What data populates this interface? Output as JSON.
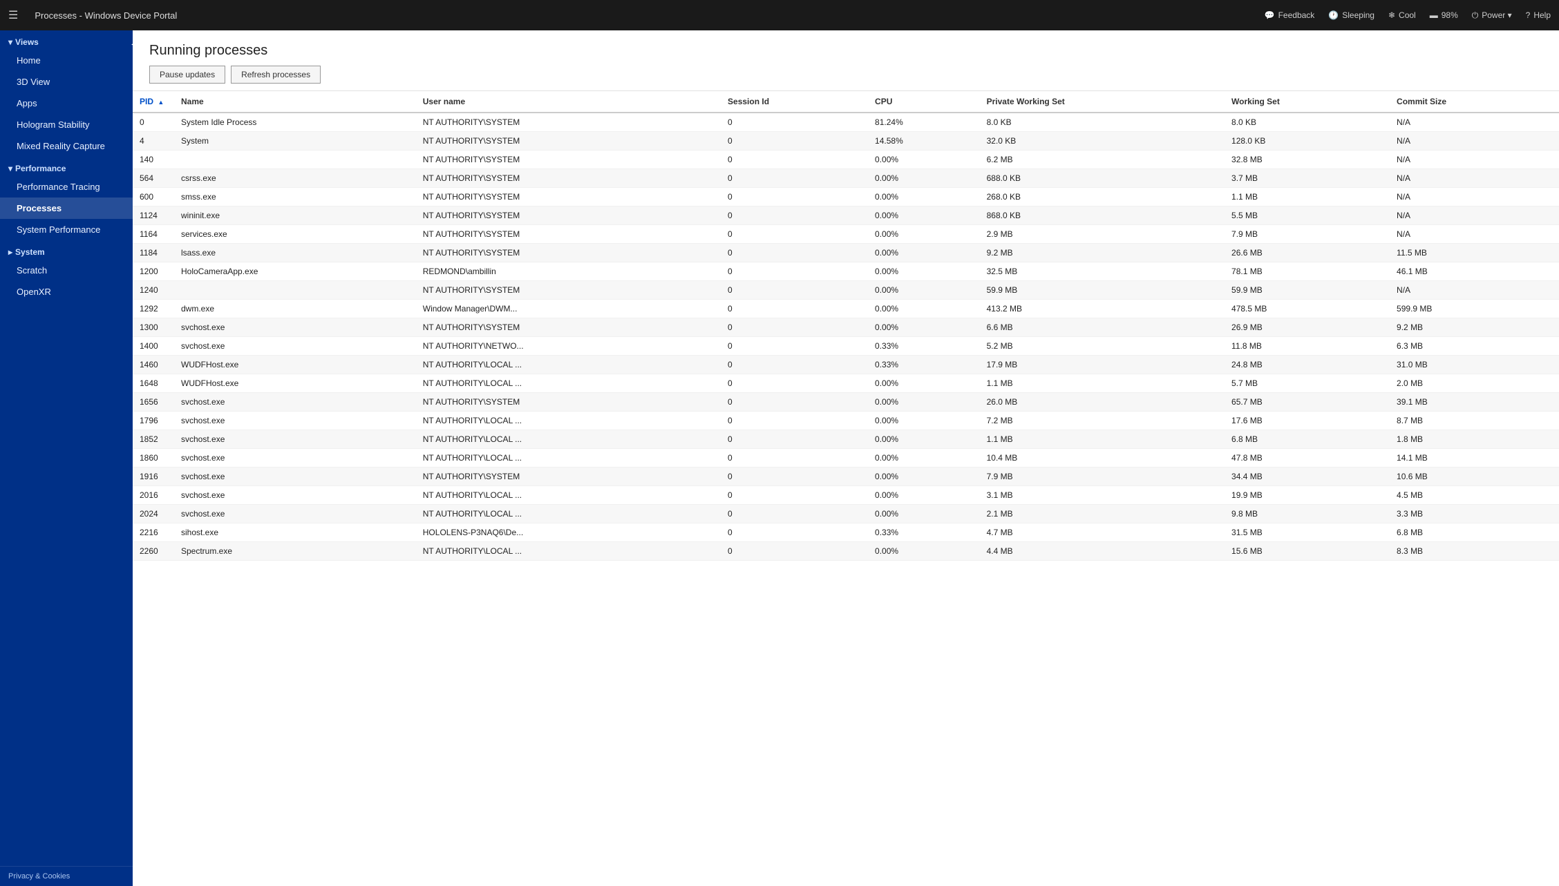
{
  "topbar": {
    "menu_icon": "☰",
    "title": "Processes - Windows Device Portal",
    "actions": [
      {
        "id": "feedback",
        "icon": "💬",
        "label": "Feedback"
      },
      {
        "id": "sleeping",
        "icon": "🕐",
        "label": "Sleeping"
      },
      {
        "id": "cool",
        "icon": "❄",
        "label": "Cool"
      },
      {
        "id": "battery",
        "icon": "🔋",
        "label": "98%"
      },
      {
        "id": "power",
        "icon": "⏻",
        "label": "Power ▾"
      },
      {
        "id": "help",
        "icon": "?",
        "label": "Help"
      }
    ]
  },
  "sidebar": {
    "toggle_icon": "◀",
    "sections": [
      {
        "id": "views",
        "label": "▾Views",
        "items": [
          {
            "id": "home",
            "label": "Home"
          },
          {
            "id": "3d-view",
            "label": "3D View"
          },
          {
            "id": "apps",
            "label": "Apps"
          }
        ]
      },
      {
        "id": "standalone",
        "items": [
          {
            "id": "hologram-stability",
            "label": "Hologram Stability"
          },
          {
            "id": "mixed-reality-capture",
            "label": "Mixed Reality Capture"
          }
        ]
      },
      {
        "id": "performance",
        "label": "▾Performance",
        "items": [
          {
            "id": "performance-tracing",
            "label": "Performance Tracing"
          },
          {
            "id": "processes",
            "label": "Processes",
            "active": true
          },
          {
            "id": "system-performance",
            "label": "System Performance"
          }
        ]
      },
      {
        "id": "system",
        "label": "▸System",
        "items": []
      },
      {
        "id": "scratch-openxr",
        "items": [
          {
            "id": "scratch",
            "label": "Scratch"
          },
          {
            "id": "openxr",
            "label": "OpenXR"
          }
        ]
      }
    ],
    "footer": "Privacy & Cookies"
  },
  "main": {
    "title": "Running processes",
    "buttons": [
      {
        "id": "pause-updates",
        "label": "Pause updates"
      },
      {
        "id": "refresh-processes",
        "label": "Refresh processes"
      }
    ],
    "table": {
      "columns": [
        {
          "id": "pid",
          "label": "PID",
          "sorted": true
        },
        {
          "id": "name",
          "label": "Name"
        },
        {
          "id": "username",
          "label": "User name"
        },
        {
          "id": "session",
          "label": "Session Id"
        },
        {
          "id": "cpu",
          "label": "CPU"
        },
        {
          "id": "private-ws",
          "label": "Private Working Set"
        },
        {
          "id": "working-set",
          "label": "Working Set"
        },
        {
          "id": "commit",
          "label": "Commit Size"
        }
      ],
      "rows": [
        {
          "pid": "0",
          "name": "System Idle Process",
          "username": "NT AUTHORITY\\SYSTEM",
          "session": "0",
          "cpu": "81.24%",
          "private_ws": "8.0 KB",
          "working_set": "8.0 KB",
          "commit": "N/A"
        },
        {
          "pid": "4",
          "name": "System",
          "username": "NT AUTHORITY\\SYSTEM",
          "session": "0",
          "cpu": "14.58%",
          "private_ws": "32.0 KB",
          "working_set": "128.0 KB",
          "commit": "N/A"
        },
        {
          "pid": "140",
          "name": "",
          "username": "NT AUTHORITY\\SYSTEM",
          "session": "0",
          "cpu": "0.00%",
          "private_ws": "6.2 MB",
          "working_set": "32.8 MB",
          "commit": "N/A"
        },
        {
          "pid": "564",
          "name": "csrss.exe",
          "username": "NT AUTHORITY\\SYSTEM",
          "session": "0",
          "cpu": "0.00%",
          "private_ws": "688.0 KB",
          "working_set": "3.7 MB",
          "commit": "N/A"
        },
        {
          "pid": "600",
          "name": "smss.exe",
          "username": "NT AUTHORITY\\SYSTEM",
          "session": "0",
          "cpu": "0.00%",
          "private_ws": "268.0 KB",
          "working_set": "1.1 MB",
          "commit": "N/A"
        },
        {
          "pid": "1124",
          "name": "wininit.exe",
          "username": "NT AUTHORITY\\SYSTEM",
          "session": "0",
          "cpu": "0.00%",
          "private_ws": "868.0 KB",
          "working_set": "5.5 MB",
          "commit": "N/A"
        },
        {
          "pid": "1164",
          "name": "services.exe",
          "username": "NT AUTHORITY\\SYSTEM",
          "session": "0",
          "cpu": "0.00%",
          "private_ws": "2.9 MB",
          "working_set": "7.9 MB",
          "commit": "N/A"
        },
        {
          "pid": "1184",
          "name": "lsass.exe",
          "username": "NT AUTHORITY\\SYSTEM",
          "session": "0",
          "cpu": "0.00%",
          "private_ws": "9.2 MB",
          "working_set": "26.6 MB",
          "commit": "11.5 MB"
        },
        {
          "pid": "1200",
          "name": "HoloCameraApp.exe",
          "username": "REDMOND\\ambillin",
          "session": "0",
          "cpu": "0.00%",
          "private_ws": "32.5 MB",
          "working_set": "78.1 MB",
          "commit": "46.1 MB"
        },
        {
          "pid": "1240",
          "name": "",
          "username": "NT AUTHORITY\\SYSTEM",
          "session": "0",
          "cpu": "0.00%",
          "private_ws": "59.9 MB",
          "working_set": "59.9 MB",
          "commit": "N/A"
        },
        {
          "pid": "1292",
          "name": "dwm.exe",
          "username": "Window Manager\\DWM...",
          "session": "0",
          "cpu": "0.00%",
          "private_ws": "413.2 MB",
          "working_set": "478.5 MB",
          "commit": "599.9 MB"
        },
        {
          "pid": "1300",
          "name": "svchost.exe",
          "username": "NT AUTHORITY\\SYSTEM",
          "session": "0",
          "cpu": "0.00%",
          "private_ws": "6.6 MB",
          "working_set": "26.9 MB",
          "commit": "9.2 MB"
        },
        {
          "pid": "1400",
          "name": "svchost.exe",
          "username": "NT AUTHORITY\\NETWO...",
          "session": "0",
          "cpu": "0.33%",
          "private_ws": "5.2 MB",
          "working_set": "11.8 MB",
          "commit": "6.3 MB"
        },
        {
          "pid": "1460",
          "name": "WUDFHost.exe",
          "username": "NT AUTHORITY\\LOCAL ...",
          "session": "0",
          "cpu": "0.33%",
          "private_ws": "17.9 MB",
          "working_set": "24.8 MB",
          "commit": "31.0 MB"
        },
        {
          "pid": "1648",
          "name": "WUDFHost.exe",
          "username": "NT AUTHORITY\\LOCAL ...",
          "session": "0",
          "cpu": "0.00%",
          "private_ws": "1.1 MB",
          "working_set": "5.7 MB",
          "commit": "2.0 MB"
        },
        {
          "pid": "1656",
          "name": "svchost.exe",
          "username": "NT AUTHORITY\\SYSTEM",
          "session": "0",
          "cpu": "0.00%",
          "private_ws": "26.0 MB",
          "working_set": "65.7 MB",
          "commit": "39.1 MB"
        },
        {
          "pid": "1796",
          "name": "svchost.exe",
          "username": "NT AUTHORITY\\LOCAL ...",
          "session": "0",
          "cpu": "0.00%",
          "private_ws": "7.2 MB",
          "working_set": "17.6 MB",
          "commit": "8.7 MB"
        },
        {
          "pid": "1852",
          "name": "svchost.exe",
          "username": "NT AUTHORITY\\LOCAL ...",
          "session": "0",
          "cpu": "0.00%",
          "private_ws": "1.1 MB",
          "working_set": "6.8 MB",
          "commit": "1.8 MB"
        },
        {
          "pid": "1860",
          "name": "svchost.exe",
          "username": "NT AUTHORITY\\LOCAL ...",
          "session": "0",
          "cpu": "0.00%",
          "private_ws": "10.4 MB",
          "working_set": "47.8 MB",
          "commit": "14.1 MB"
        },
        {
          "pid": "1916",
          "name": "svchost.exe",
          "username": "NT AUTHORITY\\SYSTEM",
          "session": "0",
          "cpu": "0.00%",
          "private_ws": "7.9 MB",
          "working_set": "34.4 MB",
          "commit": "10.6 MB"
        },
        {
          "pid": "2016",
          "name": "svchost.exe",
          "username": "NT AUTHORITY\\LOCAL ...",
          "session": "0",
          "cpu": "0.00%",
          "private_ws": "3.1 MB",
          "working_set": "19.9 MB",
          "commit": "4.5 MB"
        },
        {
          "pid": "2024",
          "name": "svchost.exe",
          "username": "NT AUTHORITY\\LOCAL ...",
          "session": "0",
          "cpu": "0.00%",
          "private_ws": "2.1 MB",
          "working_set": "9.8 MB",
          "commit": "3.3 MB"
        },
        {
          "pid": "2216",
          "name": "sihost.exe",
          "username": "HOLOLENS-P3NAQ6\\De...",
          "session": "0",
          "cpu": "0.33%",
          "private_ws": "4.7 MB",
          "working_set": "31.5 MB",
          "commit": "6.8 MB"
        },
        {
          "pid": "2260",
          "name": "Spectrum.exe",
          "username": "NT AUTHORITY\\LOCAL ...",
          "session": "0",
          "cpu": "0.00%",
          "private_ws": "4.4 MB",
          "working_set": "15.6 MB",
          "commit": "8.3 MB"
        }
      ]
    }
  }
}
